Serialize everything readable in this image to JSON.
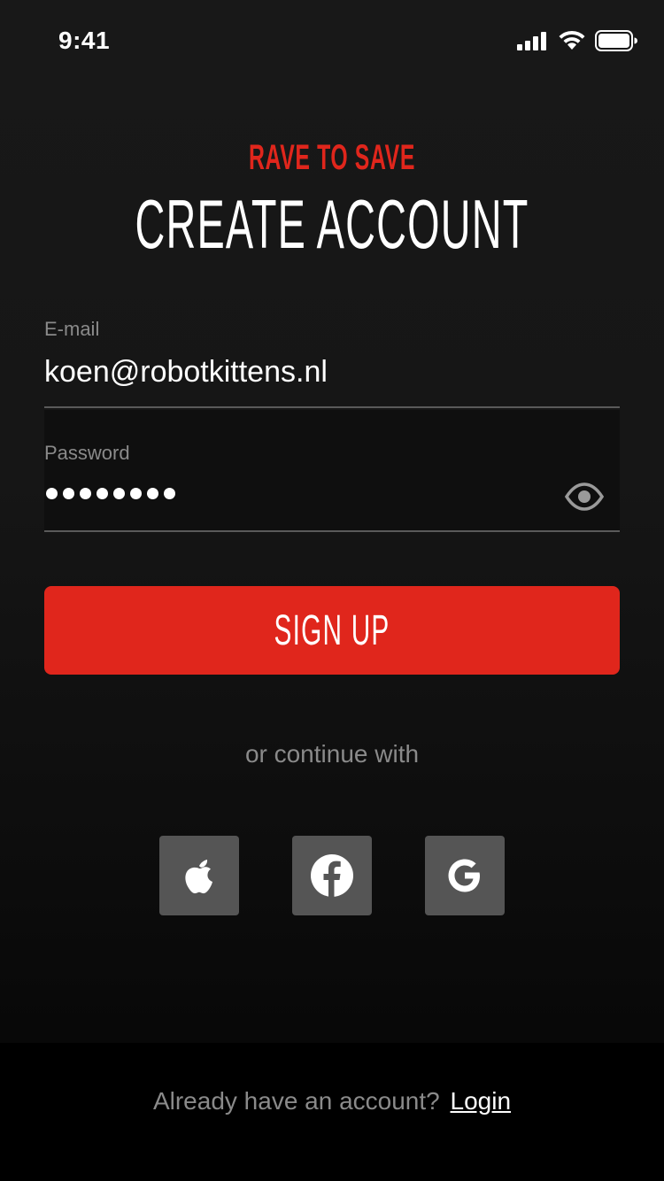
{
  "status_bar": {
    "time": "9:41",
    "icons": [
      "signal-icon",
      "wifi-icon",
      "battery-icon"
    ]
  },
  "header": {
    "brand": "RAVE TO SAVE",
    "title": "CREATE ACCOUNT"
  },
  "form": {
    "email": {
      "label": "E-mail",
      "value": "koen@robotkittens.nl"
    },
    "password": {
      "label": "Password",
      "masked_length": 8,
      "toggle_icon": "eye-icon"
    },
    "signup_label": "SIGN UP"
  },
  "social": {
    "divider_text": "or continue with",
    "providers": [
      {
        "name": "apple",
        "icon": "apple-icon"
      },
      {
        "name": "facebook",
        "icon": "facebook-icon"
      },
      {
        "name": "google",
        "icon": "google-icon"
      }
    ]
  },
  "footer": {
    "prompt": "Already have an account?",
    "login_label": "Login"
  },
  "colors": {
    "accent": "#e0261c",
    "background": "#161616",
    "muted_text": "#8a8a8a",
    "social_button": "#555555"
  }
}
